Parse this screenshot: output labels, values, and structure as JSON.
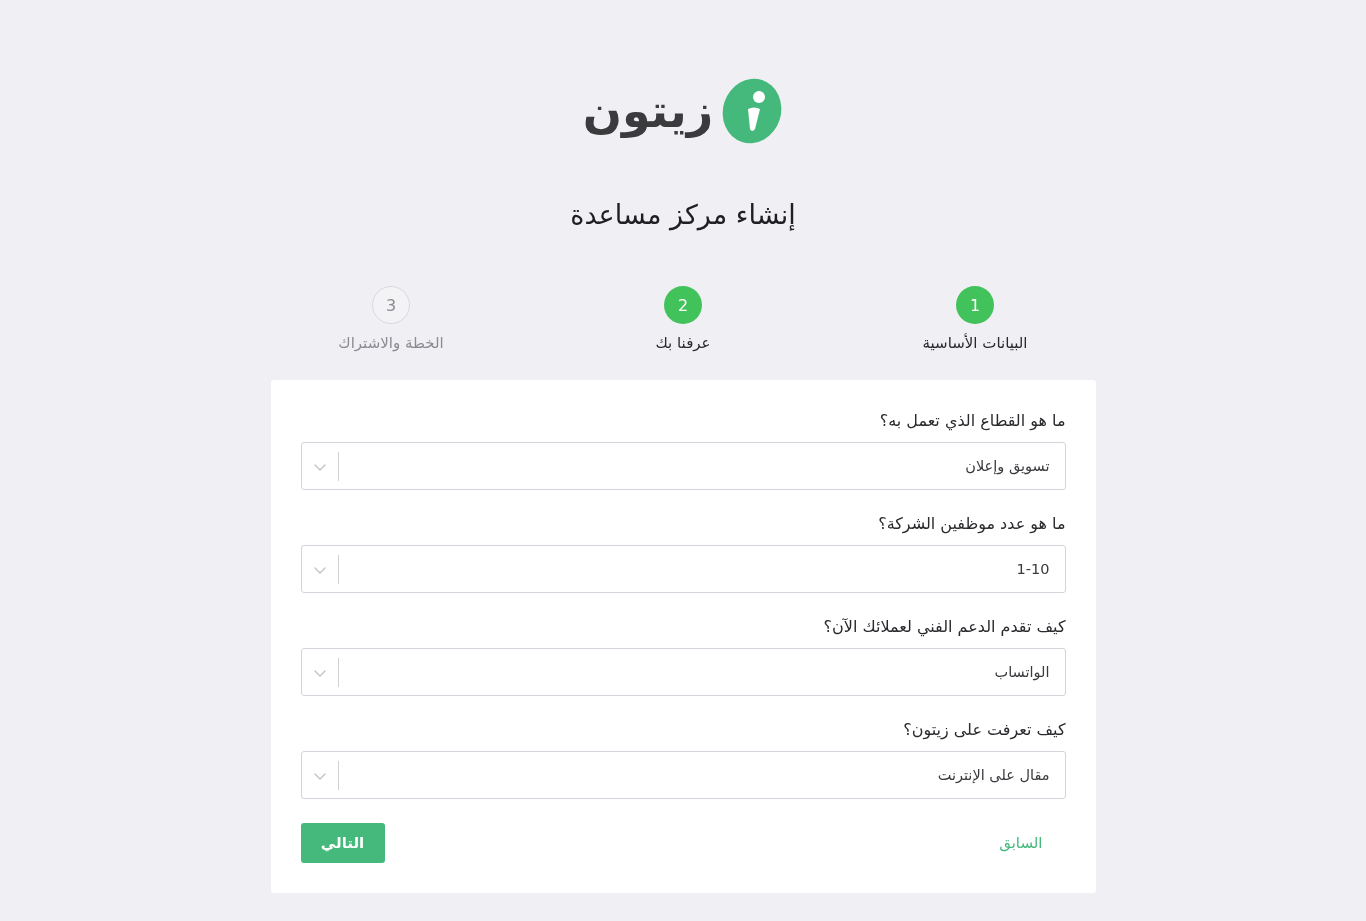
{
  "logo": {
    "text": "زيتون"
  },
  "title": "إنشاء مركز مساعدة",
  "steps": [
    {
      "number": "1",
      "label": "البيانات الأساسية",
      "active": true
    },
    {
      "number": "2",
      "label": "عرفنا بك",
      "active": true
    },
    {
      "number": "3",
      "label": "الخطة والاشتراك",
      "active": false
    }
  ],
  "form": {
    "fields": [
      {
        "label": "ما هو القطاع الذي تعمل به؟",
        "value": "تسويق وإعلان"
      },
      {
        "label": "ما هو عدد موظفين الشركة؟",
        "value": "1-10"
      },
      {
        "label": "كيف تقدم الدعم الفني لعملائك الآن؟",
        "value": "الواتساب"
      },
      {
        "label": "كيف تعرفت على زيتون؟",
        "value": "مقال على الإنترنت"
      }
    ],
    "buttons": [
      {
        "kind": "link",
        "label": "السابق"
      },
      {
        "kind": "primary",
        "label": "التالي"
      }
    ]
  }
}
